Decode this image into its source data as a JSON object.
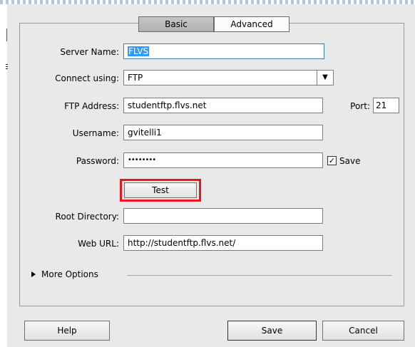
{
  "tabs": [
    {
      "label": "Basic",
      "active": true
    },
    {
      "label": "Advanced",
      "active": false
    }
  ],
  "form": {
    "server_name": {
      "label": "Server Name:",
      "value": "FLVS"
    },
    "connect_using": {
      "label": "Connect using:",
      "value": "FTP"
    },
    "ftp_address": {
      "label": "FTP Address:",
      "value": "studentftp.flvs.net"
    },
    "port": {
      "label": "Port:",
      "value": "21"
    },
    "username": {
      "label": "Username:",
      "value": "gvitelli1"
    },
    "password": {
      "label": "Password:",
      "value": "••••••••"
    },
    "save_password": {
      "label": "Save",
      "checked": true
    },
    "test_button": "Test",
    "root_directory": {
      "label": "Root Directory:",
      "value": ""
    },
    "web_url": {
      "label": "Web URL:",
      "value": "http://studentftp.flvs.net/"
    },
    "more_options": "More Options"
  },
  "footer": {
    "help": "Help",
    "save": "Save",
    "cancel": "Cancel"
  },
  "icons": {
    "dropdown": "chevron-down-icon",
    "checkmark": "check-icon",
    "disclosure": "triangle-right-icon"
  },
  "colors": {
    "highlight": "#e8181d",
    "selection": "#3399ff",
    "focus_border": "#3c7fb1"
  }
}
